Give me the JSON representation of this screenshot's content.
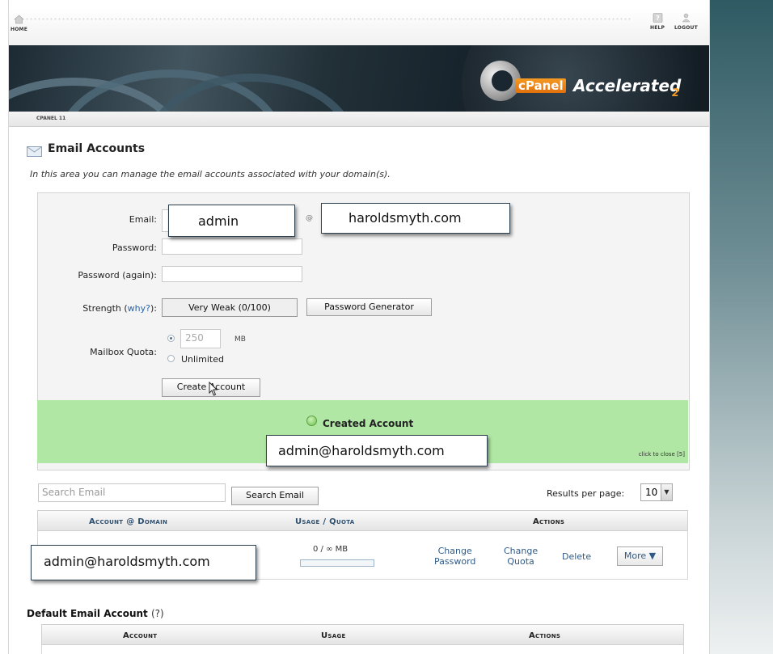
{
  "topbar": {
    "home_label": "HOME",
    "help_label": "HELP",
    "logout_label": "LOGOUT"
  },
  "banner": {
    "logo_cpanel": "cPanel",
    "logo_accelerated": "Accelerated",
    "logo_version": "2"
  },
  "version_label": "CPANEL 11",
  "page": {
    "title": "Email Accounts",
    "description": "In this area you can manage the email accounts associated with your domain(s)."
  },
  "form": {
    "email_label": "Email:",
    "email_value": "admin",
    "at_symbol": "@",
    "domain_value": "haroldsmyth.com",
    "password_label": "Password:",
    "password_again_label": "Password (again):",
    "strength_label": "Strength (",
    "strength_why": "why?",
    "strength_suffix": "):",
    "strength_value": "Very Weak (0/100)",
    "password_generator": "Password Generator",
    "quota_label": "Mailbox Quota:",
    "quota_value": "250",
    "quota_unit": "MB",
    "unlimited_label": "Unlimited",
    "create_button": "Create Account"
  },
  "success": {
    "message": "Created Account",
    "account": "admin@haroldsmyth.com",
    "close_text": "click to close [5]"
  },
  "search": {
    "placeholder": "Search Email",
    "button": "Search Email",
    "results_label": "Results per page:",
    "results_value": "10"
  },
  "table": {
    "headers": {
      "account": "Account",
      "at": "@",
      "domain": "Domain",
      "usage": "Usage",
      "slash": "/",
      "quota": "Quota",
      "actions": "Actions"
    },
    "rows": [
      {
        "account": "admin@haroldsmyth.com",
        "usage": "0 / ∞ MB",
        "usage_fraction": 0,
        "change_password_1": "Change",
        "change_password_2": "Password",
        "change_quota_1": "Change",
        "change_quota_2": "Quota",
        "delete": "Delete",
        "more": "More ▼"
      }
    ]
  },
  "default_account": {
    "title": "Default Email Account",
    "help": "(?)",
    "headers": {
      "account": "Account",
      "usage": "Usage",
      "actions": "Actions"
    }
  },
  "colors": {
    "success_bg": "#b1e7a4",
    "link": "#2f5a86",
    "logo_orange": "#f59a23"
  }
}
